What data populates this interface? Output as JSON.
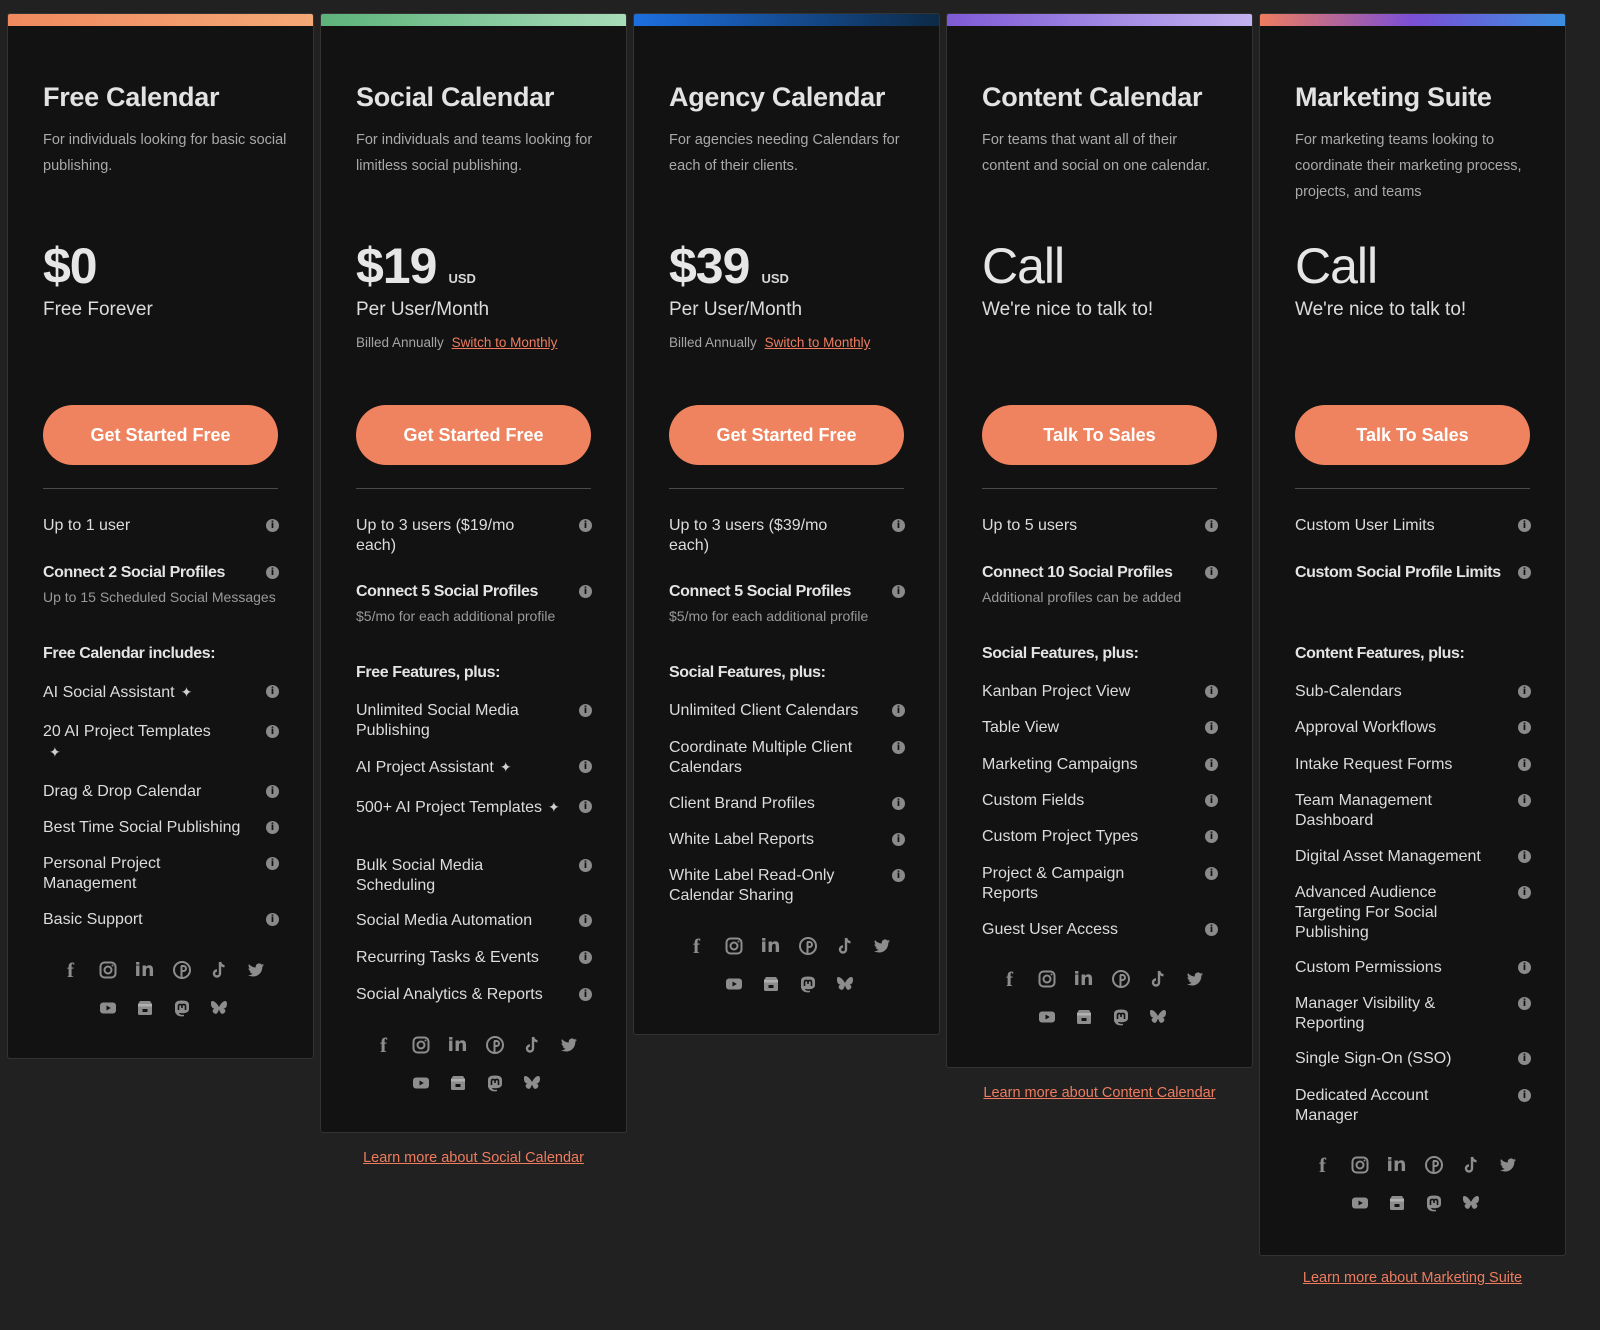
{
  "plans": [
    {
      "title": "Free Calendar",
      "desc": "For individuals looking for basic social publishing.",
      "price": "$0",
      "currency": "",
      "period": "Free Forever",
      "billing": "",
      "billing_link": "",
      "cta": "Get Started Free",
      "features": [
        {
          "label": "Up to 1 user"
        },
        {
          "label": "Connect 2 Social Profiles",
          "sub": "Up to 15 Scheduled Social Messages"
        },
        {
          "label": "Free Calendar includes:"
        },
        {
          "label": "AI Social Assistant"
        },
        {
          "label": "20 AI Project Templates"
        },
        {
          "label": "Drag & Drop Calendar"
        },
        {
          "label": "Best Time Social Publishing"
        },
        {
          "label": "Personal Project Management"
        },
        {
          "label": "Basic Support"
        }
      ],
      "learn_more": ""
    },
    {
      "title": "Social Calendar",
      "desc": "For individuals and teams looking for limitless social publishing.",
      "price": "$19",
      "currency": "USD",
      "period": "Per User/Month",
      "billing": "Billed Annually",
      "billing_link": "Switch to Monthly",
      "cta": "Get Started Free",
      "features": [
        {
          "label": "Up to 3 users ($19/mo each)"
        },
        {
          "label": "Connect 5 Social Profiles",
          "sub": "$5/mo for each additional profile"
        },
        {
          "label": "Free Features, plus:"
        },
        {
          "label": "Unlimited Social Media Publishing"
        },
        {
          "label": "AI Project Assistant"
        },
        {
          "label": "500+ AI Project Templates"
        },
        {
          "label": "Bulk Social Media Scheduling"
        },
        {
          "label": "Social Media Automation"
        },
        {
          "label": "Recurring Tasks & Events"
        },
        {
          "label": "Social Analytics & Reports"
        }
      ],
      "learn_more": "Learn more about Social Calendar"
    },
    {
      "title": "Agency Calendar",
      "desc": "For agencies needing Calendars for each of their clients.",
      "price": "$39",
      "currency": "USD",
      "period": "Per User/Month",
      "billing": "Billed Annually",
      "billing_link": "Switch to Monthly",
      "cta": "Get Started Free",
      "features": [
        {
          "label": "Up to 3 users ($39/mo each)"
        },
        {
          "label": "Connect 5 Social Profiles",
          "sub": "$5/mo for each additional profile"
        },
        {
          "label": "Social Features, plus:"
        },
        {
          "label": "Unlimited Client Calendars"
        },
        {
          "label": "Coordinate Multiple Client Calendars"
        },
        {
          "label": "Client Brand Profiles"
        },
        {
          "label": "White Label Reports"
        },
        {
          "label": "White Label Read-Only Calendar Sharing"
        }
      ],
      "learn_more": ""
    },
    {
      "title": "Content Calendar",
      "desc": "For teams that want all of their content and social on one calendar.",
      "price": "Call",
      "currency": "",
      "period": "We're nice to talk to!",
      "billing": "",
      "billing_link": "",
      "cta": "Talk To Sales",
      "features": [
        {
          "label": "Up to 5 users"
        },
        {
          "label": "Connect 10 Social Profiles",
          "sub": "Additional profiles can be added"
        },
        {
          "label": "Social Features, plus:"
        },
        {
          "label": "Kanban Project View"
        },
        {
          "label": "Table View"
        },
        {
          "label": "Marketing Campaigns"
        },
        {
          "label": "Custom Fields"
        },
        {
          "label": "Custom Project Types"
        },
        {
          "label": "Project & Campaign Reports"
        },
        {
          "label": "Guest User Access"
        }
      ],
      "learn_more": "Learn more about Content Calendar"
    },
    {
      "title": "Marketing Suite",
      "desc": "For marketing teams looking to coordinate their marketing process, projects, and teams",
      "price": "Call",
      "currency": "",
      "period": "We're nice to talk to!",
      "billing": "",
      "billing_link": "",
      "cta": "Talk To Sales",
      "features": [
        {
          "label": "Custom User Limits"
        },
        {
          "label": "Custom Social Profile Limits"
        },
        {
          "label": "Content Features, plus:"
        },
        {
          "label": "Sub-Calendars"
        },
        {
          "label": "Approval Workflows"
        },
        {
          "label": "Intake Request Forms"
        },
        {
          "label": "Team Management Dashboard"
        },
        {
          "label": "Digital Asset Management"
        },
        {
          "label": "Advanced Audience Targeting For Social Publishing"
        },
        {
          "label": "Custom Permissions"
        },
        {
          "label": "Manager Visibility & Reporting"
        },
        {
          "label": "Single Sign-On (SSO)"
        },
        {
          "label": "Dedicated Account Manager"
        }
      ],
      "learn_more": "Learn more about Marketing Suite"
    }
  ],
  "icons": {
    "info": "info-icon",
    "wand": "magic-wand-icon",
    "social_row1": [
      "facebook-icon",
      "instagram-icon",
      "linkedin-icon",
      "pinterest-icon",
      "tiktok-icon",
      "twitter-icon"
    ],
    "social_row2": [
      "youtube-icon",
      "google-business-icon",
      "mastodon-icon",
      "bluesky-icon"
    ]
  },
  "colors": {
    "accent": "#ef835f",
    "link": "#ef7c5f",
    "background": "#212121",
    "card": "#121212"
  }
}
